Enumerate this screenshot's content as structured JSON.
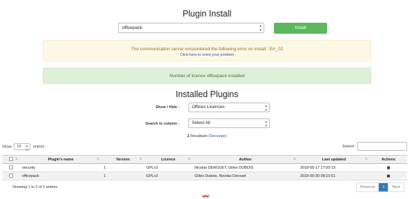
{
  "plugin_install": {
    "title": "Plugin Install",
    "selected_plugin": "officepack",
    "install_label": "Install"
  },
  "alerts": {
    "error_message": "The communication server encountered the following error on install :  Err_02",
    "error_link": "Click here to solve your problem",
    "success_message": "Number of licence officepack installed"
  },
  "installed": {
    "title": "Installed Plugins",
    "show_hide_label": "Show / Hide :",
    "show_hide_value": "Offices Licences",
    "search_in_column_label": "Search in column :",
    "search_in_column_value": "Select All",
    "result_count": "2",
    "result_text": "Resultado",
    "download_text": "(Descargar)"
  },
  "table_controls": {
    "show_label": "Show",
    "entries_value": "10",
    "entries_label": "entries",
    "search_label": "Search :",
    "info": "Showing 1 to 2 of 2 entries",
    "previous": "Previous",
    "current_page": "1",
    "next": "Next"
  },
  "table": {
    "headers": [
      "",
      "Plugin's name",
      "Version",
      "Licence",
      "Author",
      "Last updated",
      "Actions"
    ],
    "rows": [
      {
        "name": "security",
        "version": "1",
        "licence": "GPLv2",
        "author": "Nicolas DEROUET, Gilles DUBOIS",
        "updated": "2018-05-17 17:00:19",
        "action": "✖"
      },
      {
        "name": "officepack",
        "version": "1",
        "licence": "GPLv2",
        "author": "Gilles Dubois, Nicolas Derouet",
        "updated": "2018-05-30 08:10:51",
        "action": "✖"
      }
    ]
  },
  "colors": {
    "install_button": "#5cb85c",
    "warning_bg": "#fcf8e3",
    "success_bg": "#dff0d8",
    "pager_active": "#337ab7",
    "logo": "#d0302a"
  },
  "icons": {
    "sort": "sort-icon",
    "delete": "delete-icon",
    "logo": "logo-icon"
  }
}
